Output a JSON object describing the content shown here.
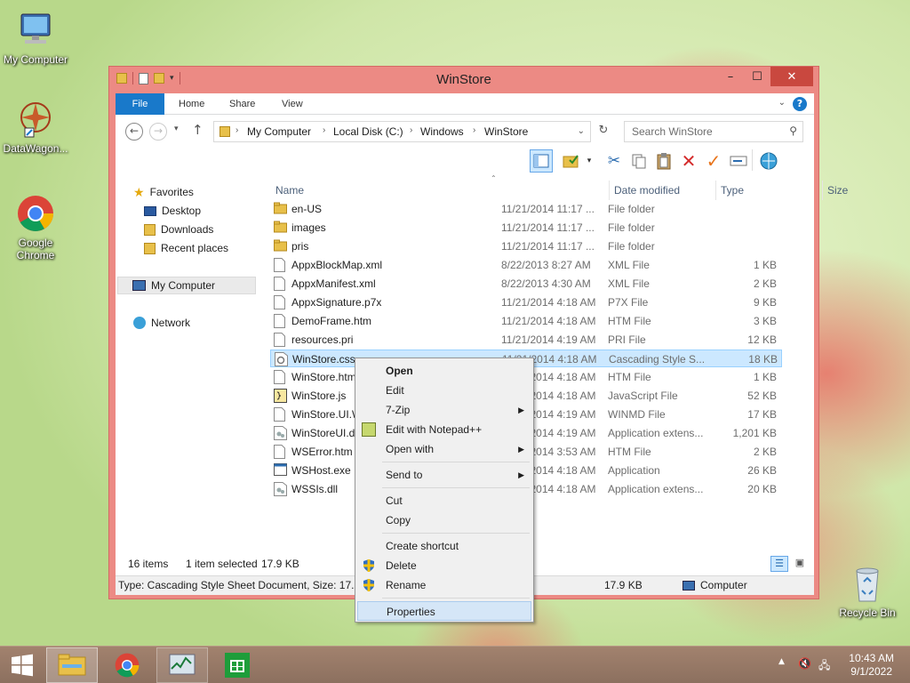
{
  "desktop": {
    "icons": [
      {
        "label": "My Computer"
      },
      {
        "label": "DataWagon..."
      },
      {
        "label": "Google Chrome"
      },
      {
        "label": "Recycle Bin"
      }
    ]
  },
  "window": {
    "title": "WinStore",
    "ribbon_tabs": [
      "File",
      "Home",
      "Share",
      "View"
    ],
    "help_label": "?",
    "buttons": {
      "minimize": "–",
      "maximize": "☐",
      "close": "✕"
    }
  },
  "address": {
    "breadcrumbs": [
      "My Computer",
      "Local Disk (C:)",
      "Windows",
      "WinStore"
    ],
    "search_placeholder": "Search WinStore"
  },
  "navpane": {
    "favorites": "Favorites",
    "favorites_items": [
      "Desktop",
      "Downloads",
      "Recent places"
    ],
    "computer": "My Computer",
    "network": "Network"
  },
  "columns": {
    "name": "Name",
    "date": "Date modified",
    "type": "Type",
    "size": "Size"
  },
  "files": [
    {
      "name": "en-US",
      "date": "11/21/2014 11:17 ...",
      "type": "File folder",
      "size": "",
      "icon": "folder"
    },
    {
      "name": "images",
      "date": "11/21/2014 11:17 ...",
      "type": "File folder",
      "size": "",
      "icon": "folder"
    },
    {
      "name": "pris",
      "date": "11/21/2014 11:17 ...",
      "type": "File folder",
      "size": "",
      "icon": "folder"
    },
    {
      "name": "AppxBlockMap.xml",
      "date": "8/22/2013 8:27 AM",
      "type": "XML File",
      "size": "1 KB",
      "icon": "doc"
    },
    {
      "name": "AppxManifest.xml",
      "date": "8/22/2013 4:30 AM",
      "type": "XML File",
      "size": "2 KB",
      "icon": "doc"
    },
    {
      "name": "AppxSignature.p7x",
      "date": "11/21/2014 4:18 AM",
      "type": "P7X File",
      "size": "9 KB",
      "icon": "doc"
    },
    {
      "name": "DemoFrame.htm",
      "date": "11/21/2014 4:18 AM",
      "type": "HTM File",
      "size": "3 KB",
      "icon": "doc"
    },
    {
      "name": "resources.pri",
      "date": "11/21/2014 4:19 AM",
      "type": "PRI File",
      "size": "12 KB",
      "icon": "doc"
    },
    {
      "name": "WinStore.css",
      "date": "11/21/2014 4:18 AM",
      "type": "Cascading Style S...",
      "size": "18 KB",
      "icon": "gear"
    },
    {
      "name": "WinStore.htm",
      "date": "11/21/2014 4:18 AM",
      "type": "HTM File",
      "size": "1 KB",
      "icon": "doc"
    },
    {
      "name": "WinStore.js",
      "date": "11/21/2014 4:18 AM",
      "type": "JavaScript File",
      "size": "52 KB",
      "icon": "script"
    },
    {
      "name": "WinStore.UI.W",
      "date": "11/21/2014 4:19 AM",
      "type": "WINMD File",
      "size": "17 KB",
      "icon": "doc"
    },
    {
      "name": "WinStoreUI.dl",
      "date": "11/21/2014 4:19 AM",
      "type": "Application extens...",
      "size": "1,201 KB",
      "icon": "dll"
    },
    {
      "name": "WSError.htm",
      "date": "11/21/2014 3:53 AM",
      "type": "HTM File",
      "size": "2 KB",
      "icon": "doc"
    },
    {
      "name": "WSHost.exe",
      "date": "11/21/2014 4:18 AM",
      "type": "Application",
      "size": "26 KB",
      "icon": "exe"
    },
    {
      "name": "WSSIs.dll",
      "date": "11/21/2014 4:18 AM",
      "type": "Application extens...",
      "size": "20 KB",
      "icon": "dll"
    }
  ],
  "selected_index": 8,
  "status": {
    "items": "16 items",
    "selected": "1 item selected",
    "selected_size": "17.9 KB",
    "details": "Type: Cascading Style Sheet Document, Size: 17.9 K",
    "details_size": "17.9 KB",
    "details_location": "Computer"
  },
  "context_menu": {
    "open": "Open",
    "edit": "Edit",
    "zip": "7-Zip",
    "notepad": "Edit with Notepad++",
    "open_with": "Open with",
    "send_to": "Send to",
    "cut": "Cut",
    "copy": "Copy",
    "create_shortcut": "Create shortcut",
    "delete": "Delete",
    "rename": "Rename",
    "properties": "Properties"
  },
  "taskbar": {
    "time": "10:43 AM",
    "date": "9/1/2022"
  },
  "colors": {
    "window_frame": "#ec8a84",
    "accent": "#1979ca",
    "selection": "#cce8ff",
    "taskbar": "#8c705f"
  }
}
